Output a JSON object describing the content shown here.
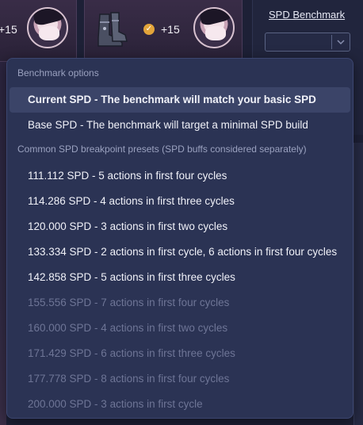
{
  "background": {
    "left_card": {
      "plus_text": "+15"
    },
    "mid_card": {
      "plus_text": "+15"
    },
    "right_panel": {
      "title": "SPD Benchmark",
      "select_value": ""
    }
  },
  "dropdown": {
    "group_benchmark": {
      "label": "Benchmark options",
      "options": [
        {
          "text": "Current SPD - The benchmark will match your basic SPD",
          "state": "selected"
        },
        {
          "text": "Base SPD - The benchmark will target a minimal SPD build",
          "state": "enabled"
        }
      ]
    },
    "group_presets": {
      "label": "Common SPD breakpoint presets (SPD buffs considered separately)",
      "options": [
        {
          "text": "111.112 SPD - 5 actions in first four cycles",
          "state": "enabled"
        },
        {
          "text": "114.286 SPD - 4 actions in first three cycles",
          "state": "enabled"
        },
        {
          "text": "120.000 SPD - 3 actions in first two cycles",
          "state": "enabled"
        },
        {
          "text": "133.334 SPD - 2 actions in first cycle, 6 actions in first four cycles",
          "state": "enabled"
        },
        {
          "text": "142.858 SPD - 5 actions in first three cycles",
          "state": "enabled"
        },
        {
          "text": "155.556 SPD - 7 actions in first four cycles",
          "state": "disabled"
        },
        {
          "text": "160.000 SPD - 4 actions in first two cycles",
          "state": "disabled"
        },
        {
          "text": "171.429 SPD - 6 actions in first three cycles",
          "state": "disabled"
        },
        {
          "text": "177.778 SPD - 8 actions in first four cycles",
          "state": "disabled"
        },
        {
          "text": "200.000 SPD - 3 actions in first cycle",
          "state": "disabled"
        }
      ]
    }
  },
  "colors": {
    "dropdown_bg": "#2b3354",
    "selected_bg": "#3b4468",
    "disabled_text": "#6e7596",
    "group_label": "#9aa1bf"
  },
  "icons": {
    "coin": "gold-coin-icon",
    "boots": "boots-relic-icon",
    "chevron": "chevron-down-icon"
  }
}
